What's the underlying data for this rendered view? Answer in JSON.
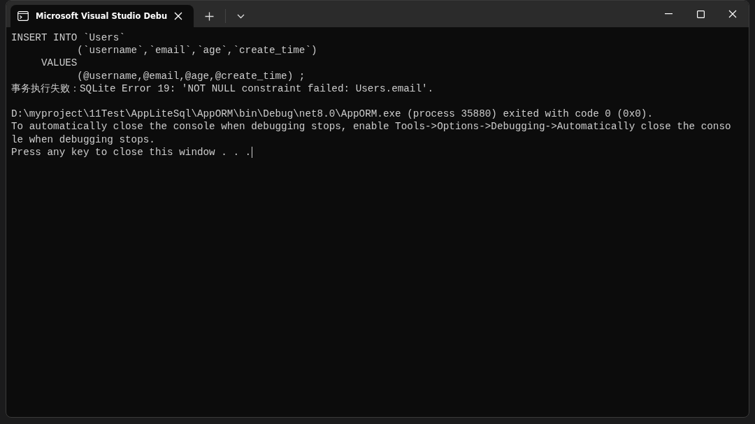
{
  "tab": {
    "title": "Microsoft Visual Studio Debu",
    "selected": true
  },
  "console": {
    "lines": [
      {
        "text": "INSERT INTO `Users`"
      },
      {
        "text": "           (`username`,`email`,`age`,`create_time`)"
      },
      {
        "text": "     VALUES"
      },
      {
        "text": "           (@username,@email,@age,@create_time) ;"
      },
      {
        "text": "事务执行失败：SQLite Error 19: 'NOT NULL constraint failed: Users.email'."
      },
      {
        "text": "D:\\myproject\\11Test\\AppLiteSql\\AppORM\\bin\\Debug\\net8.0\\AppORM.exe (process 35880) exited with code 0 (0x0).",
        "blank_before": true
      },
      {
        "text": "To automatically close the console when debugging stops, enable Tools->Options->Debugging->Automatically close the conso"
      },
      {
        "text": "le when debugging stops."
      },
      {
        "text": "Press any key to close this window . . ."
      }
    ]
  }
}
